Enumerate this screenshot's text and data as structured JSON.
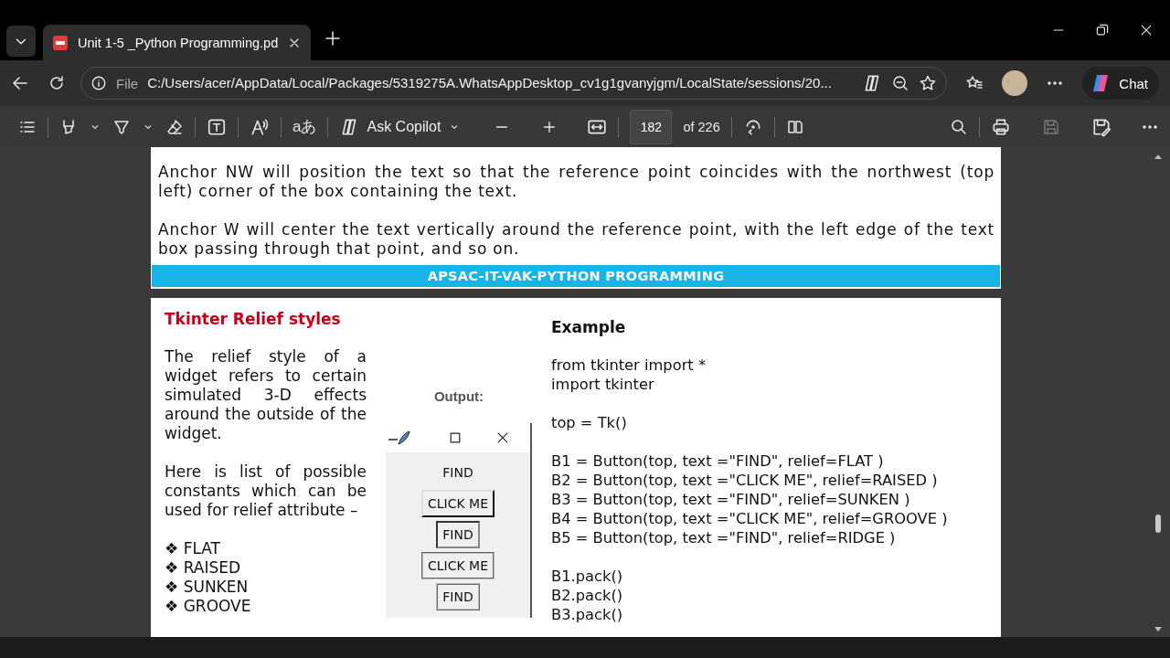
{
  "browser": {
    "tabs": [
      {
        "title": "Unit 1-5 _Python Programming.pd",
        "selected": true
      }
    ],
    "address": {
      "scheme": "File",
      "url": "C:/Users/acer/AppData/Local/Packages/5319275A.WhatsAppDesktop_cv1g1gvanyjgm/LocalState/sessions/20..."
    },
    "chat_label": "Chat"
  },
  "pdf_toolbar": {
    "ask_label": "Ask Copilot",
    "translate_glyph": "aあ",
    "page": "182",
    "page_count": "of 226"
  },
  "document": {
    "page_1": {
      "paragraphs": [
        "Anchor NW will position the text so that the reference point coincides with the northwest (top left) corner of the box containing the text.",
        "Anchor W will center the text vertically around the reference point, with the left edge of the text box passing through that point, and so on."
      ],
      "banner": "APSAC-IT-VAK-PYTHON PROGRAMMING"
    },
    "page_2": {
      "heading": "Tkinter Relief styles",
      "paragraphs": [
        "The relief style of a widget refers to certain simulated 3-D effects around the outside of the widget.",
        "Here is list of possible constants which can be used for relief attribute –"
      ],
      "constants": [
        {
          "bullet": "❖",
          "label": "FLAT"
        },
        {
          "bullet": "❖",
          "label": "RAISED"
        },
        {
          "bullet": "❖",
          "label": "SUNKEN"
        },
        {
          "bullet": "❖",
          "label": "GROOVE"
        }
      ],
      "output": {
        "label": "Output:",
        "buttons": [
          {
            "label": "FIND",
            "kind": "flat"
          },
          {
            "label": "CLICK ME",
            "kind": "raised"
          },
          {
            "label": "FIND",
            "kind": "sunken"
          },
          {
            "label": "CLICK ME",
            "kind": "groove"
          },
          {
            "label": "FIND",
            "kind": "ridge"
          }
        ]
      },
      "example": {
        "heading": "Example",
        "code_blocks": [
          [
            "from tkinter import *",
            "import tkinter"
          ],
          [
            "top = Tk()"
          ],
          [
            "B1 = Button(top, text =\"FIND\", relief=FLAT )",
            "B2 = Button(top, text =\"CLICK ME\", relief=RAISED )",
            "B3 = Button(top, text =\"FIND\", relief=SUNKEN )",
            "B4 = Button(top, text =\"CLICK ME\", relief=GROOVE )",
            "B5 = Button(top, text =\"FIND\", relief=RIDGE )"
          ],
          [
            "B1.pack()",
            "B2.pack()",
            "B3.pack()"
          ]
        ]
      }
    }
  }
}
